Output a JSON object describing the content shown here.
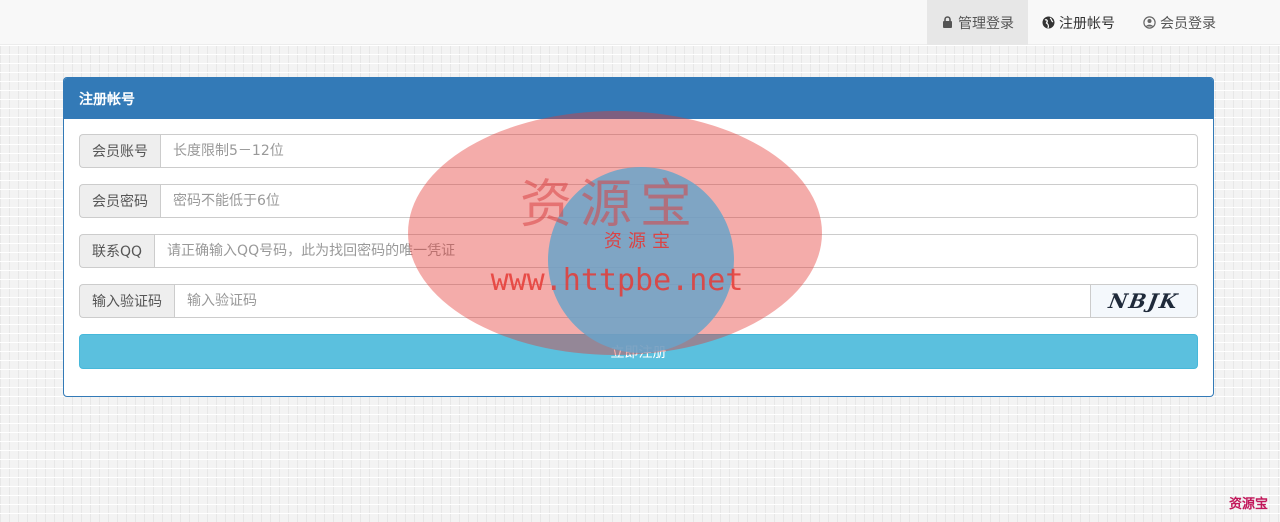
{
  "nav": {
    "items": [
      {
        "label": "管理登录",
        "icon": "lock-icon",
        "active": true
      },
      {
        "label": "注册帐号",
        "icon": "globe-icon",
        "active": false
      },
      {
        "label": "会员登录",
        "icon": "user-circle-icon",
        "active": false
      }
    ]
  },
  "panel": {
    "title": "注册帐号",
    "fields": [
      {
        "label": "会员账号",
        "placeholder": "长度限制5－12位",
        "value": ""
      },
      {
        "label": "会员密码",
        "placeholder": "密码不能低于6位",
        "value": ""
      },
      {
        "label": "联系QQ",
        "placeholder": "请正确输入QQ号码，此为找回密码的唯一凭证",
        "value": ""
      },
      {
        "label": "输入验证码",
        "placeholder": "输入验证码",
        "value": ""
      }
    ],
    "captcha_text": "NBJK",
    "submit_label": "立即注册"
  },
  "watermark": {
    "big_text": "资源宝",
    "small_text": "资源宝",
    "url_text": "www.httpbe.net",
    "corner_text": "资源宝"
  },
  "colors": {
    "primary": "#337ab7",
    "info": "#5bc0de",
    "watermark_red": "#e53935",
    "watermark_blue": "#6aa3c9"
  }
}
